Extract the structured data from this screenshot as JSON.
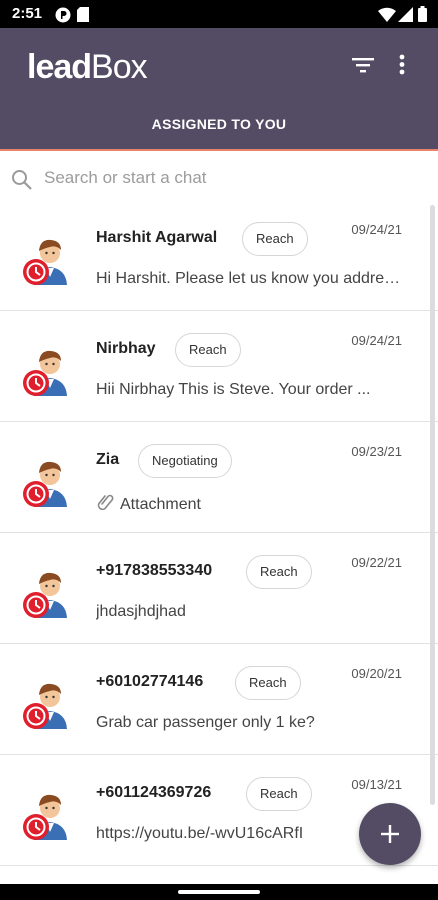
{
  "status_bar": {
    "time": "2:51",
    "icons": [
      "notification-p-icon",
      "sd-card-icon",
      "wifi-icon",
      "signal-icon",
      "battery-icon"
    ]
  },
  "app_bar": {
    "logo_lead": "lead",
    "logo_box": "Box",
    "tab": "ASSIGNED TO YOU",
    "background": "#534c64",
    "accent": "#e9836b"
  },
  "search": {
    "placeholder": "Search or start a chat",
    "value": ""
  },
  "chats": [
    {
      "name": "Harshit Agarwal",
      "stage": "Reach",
      "date": "09/24/21",
      "preview": "Hi Harshit. Please let us know you address for the delivery"
    },
    {
      "name": "Nirbhay",
      "stage": "Reach",
      "date": "09/24/21",
      "preview": "Hii Nirbhay This is Steve. Your order ..."
    },
    {
      "name": "Zia",
      "stage": "Negotiating",
      "date": "09/23/21",
      "preview": "Attachment",
      "attachment": true
    },
    {
      "name": "+917838553340",
      "stage": "Reach",
      "date": "09/22/21",
      "preview": "jhdasjhdjhad"
    },
    {
      "name": "+60102774146",
      "stage": "Reach",
      "date": "09/20/21",
      "preview": "Grab car passenger only 1 ke?"
    },
    {
      "name": "+601124369726",
      "stage": "Reach",
      "date": "09/13/21",
      "preview": "https://youtu.be/-wvU16cARfI"
    }
  ]
}
